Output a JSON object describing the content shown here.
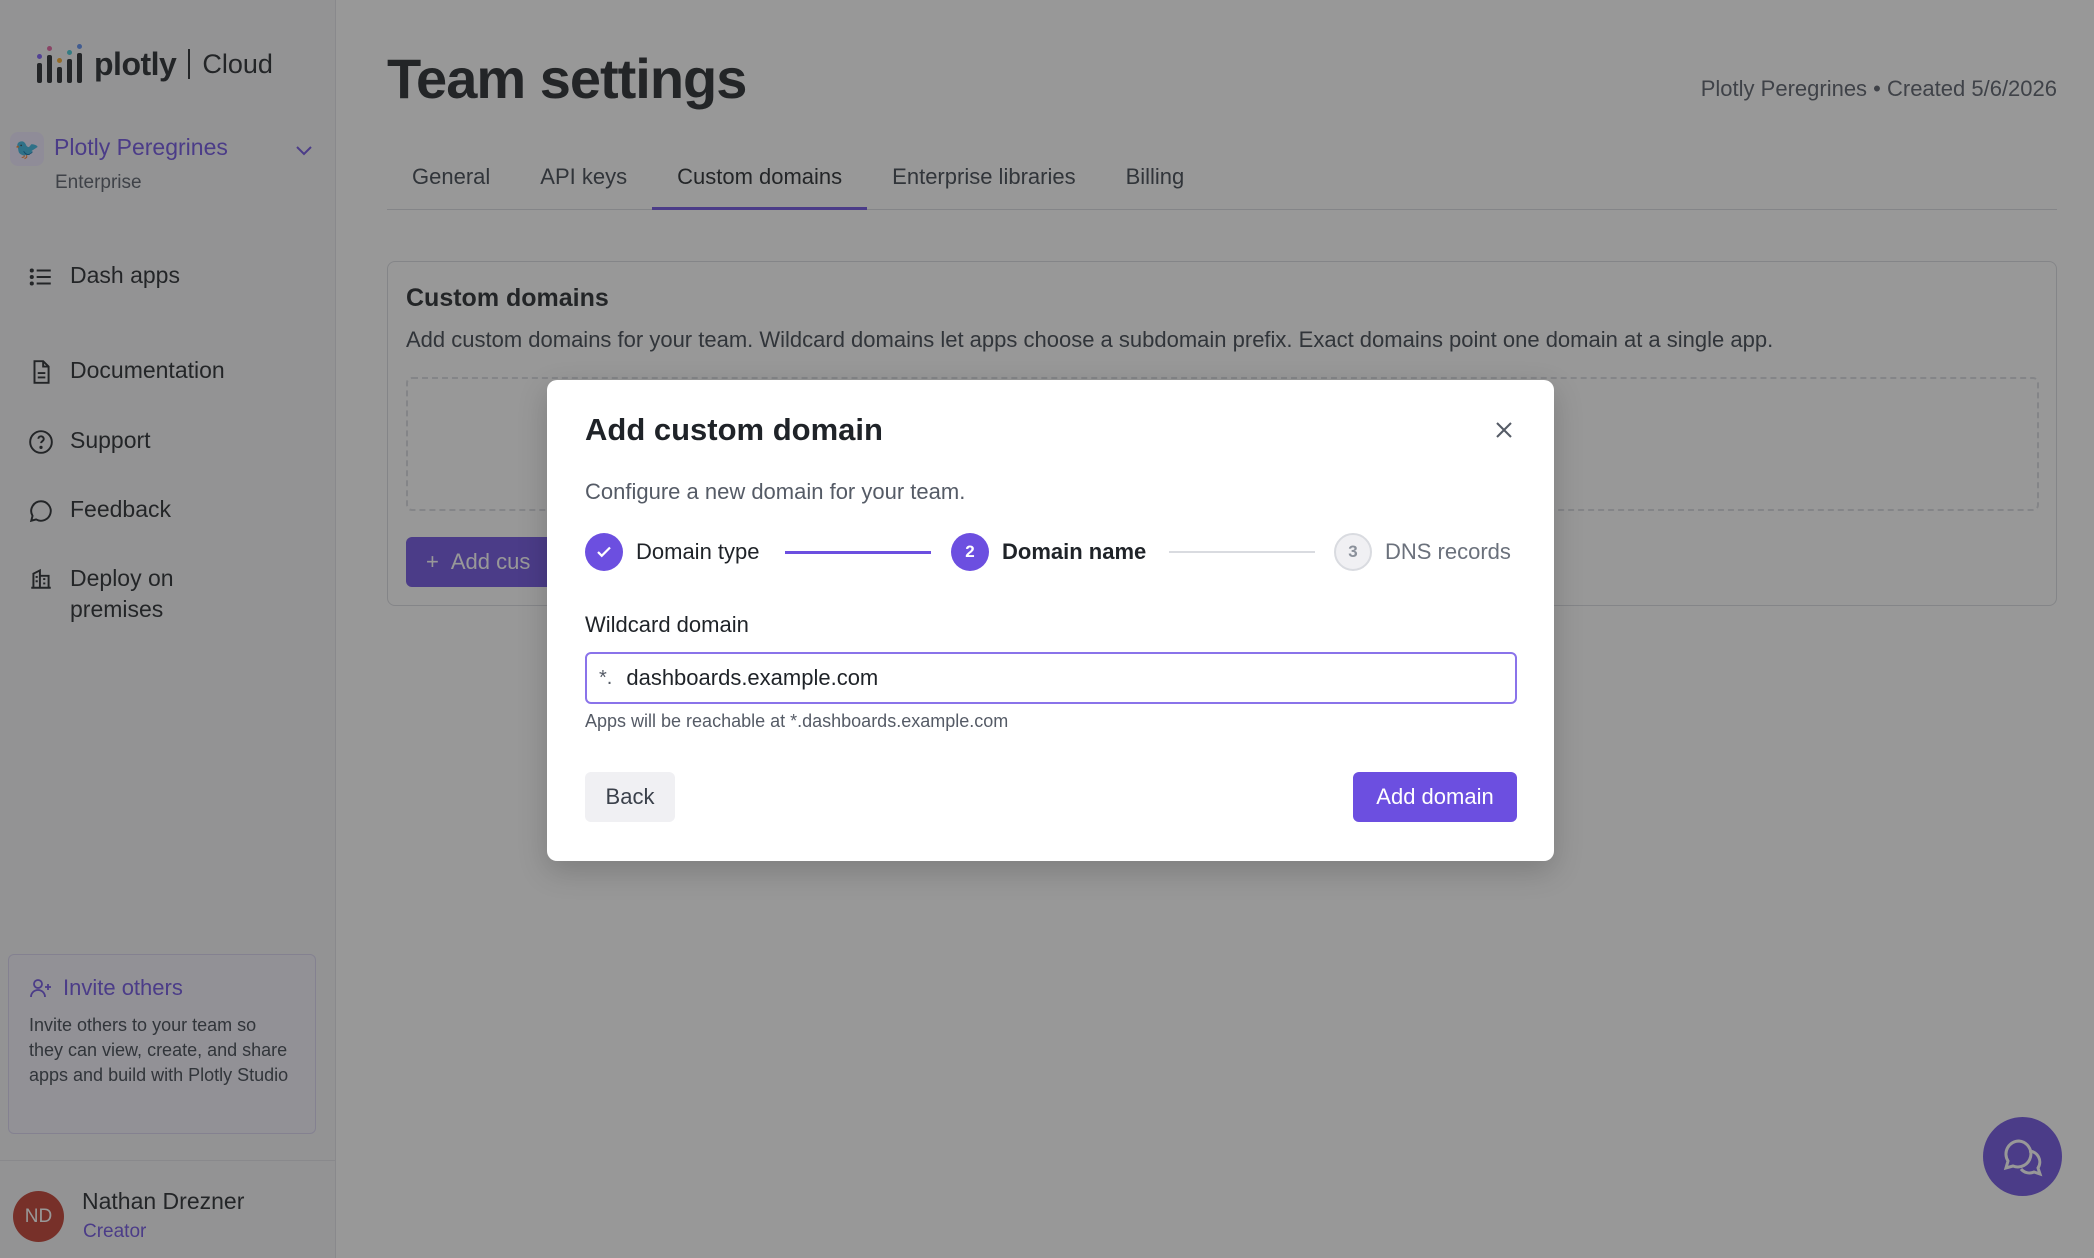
{
  "brand": {
    "name": "plotly",
    "product": "Cloud"
  },
  "sidebar": {
    "team": {
      "name": "Plotly Peregrines",
      "plan": "Enterprise"
    },
    "nav": [
      {
        "label": "Dash apps",
        "icon": "list-icon"
      },
      {
        "label": "Documentation",
        "icon": "document-icon"
      },
      {
        "label": "Support",
        "icon": "help-circle-icon"
      },
      {
        "label": "Feedback",
        "icon": "chat-bubble-icon"
      },
      {
        "label": "Deploy on premises",
        "icon": "building-icon"
      }
    ],
    "invite": {
      "title": "Invite others",
      "text": "Invite others to your team so they can view, create, and share apps and build with Plotly Studio"
    },
    "user": {
      "initials": "ND",
      "name": "Nathan Drezner",
      "role": "Creator"
    }
  },
  "page": {
    "title": "Team settings",
    "meta": "Plotly Peregrines • Created 5/6/2026",
    "tabs": [
      {
        "label": "General",
        "active": false
      },
      {
        "label": "API keys",
        "active": false
      },
      {
        "label": "Custom domains",
        "active": true
      },
      {
        "label": "Enterprise libraries",
        "active": false
      },
      {
        "label": "Billing",
        "active": false
      }
    ],
    "card": {
      "title": "Custom domains",
      "description": "Add custom domains for your team. Wildcard domains let apps choose a subdomain prefix. Exact domains point one domain at a single app.",
      "add_button": "Add cus"
    }
  },
  "modal": {
    "title": "Add custom domain",
    "subtitle": "Configure a new domain for your team.",
    "steps": [
      {
        "number": "",
        "label": "Domain type",
        "state": "done"
      },
      {
        "number": "2",
        "label": "Domain name",
        "state": "active"
      },
      {
        "number": "3",
        "label": "DNS records",
        "state": "todo"
      }
    ],
    "field": {
      "label": "Wildcard domain",
      "prefix": "*.",
      "value": "dashboards.example.com",
      "help": "Apps will be reachable at *.dashboards.example.com"
    },
    "back_label": "Back",
    "submit_label": "Add domain"
  },
  "colors": {
    "accent": "#6c4fe0",
    "overlay": "rgba(40,40,40,0.48)"
  }
}
